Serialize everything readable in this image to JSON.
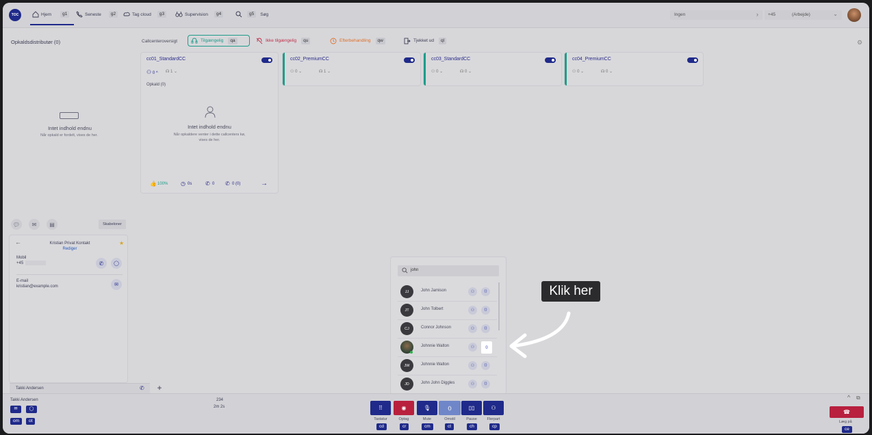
{
  "topbar": {
    "logo": "TOC",
    "nav": [
      {
        "label": "Hjem",
        "key": "g1",
        "icon": "home-icon"
      },
      {
        "label": "Seneste",
        "key": "g2",
        "icon": "phone-icon"
      },
      {
        "label": "Tag cloud",
        "key": "g3",
        "icon": "tag-icon"
      },
      {
        "label": "Supervision",
        "key": "g4",
        "icon": "binoculars-icon"
      },
      {
        "label": "Søg",
        "key": "g5",
        "icon": "search-icon"
      }
    ],
    "status_select": "Ingen",
    "phone_prefix": "+45",
    "phone_label": "(Arbejde)"
  },
  "left_panel": {
    "title": "Opkaldsdistributør (0)",
    "empty_title": "Intet indhold endnu",
    "empty_text": "Når opkald er fordelt, vises de her."
  },
  "callcenter": {
    "label": "Callcenteroversigt",
    "filters": [
      {
        "label": "Tilgængelig",
        "key": "qa"
      },
      {
        "label": "Ikke tilgængelig",
        "key": "qu"
      },
      {
        "label": "Efterbehandling",
        "key": "qw"
      },
      {
        "label": "Tjekket ud",
        "key": "ql"
      }
    ],
    "cards": [
      {
        "name": "cc01_StandardCC",
        "agents": "0",
        "waiting": "1"
      },
      {
        "name": "cc02_PremiumCC",
        "agents": "0",
        "waiting": "1"
      },
      {
        "name": "cc03_StandardCC",
        "agents": "0",
        "waiting": "0"
      },
      {
        "name": "cc04_PremiumCC",
        "agents": "0",
        "waiting": "0"
      }
    ],
    "calls_label": "Opkald (0)",
    "empty_title": "Intet indhold endnu",
    "empty_text": "Når opkaldere venter i dette callcenters kø, vises de her.",
    "stats": {
      "percent": "100%",
      "time": "0s",
      "calls": "0",
      "missed": "0 (0)"
    }
  },
  "contact": {
    "templates_button": "Skabeloner",
    "name": "Kristian Privat Kontakt",
    "edit": "Rediger",
    "mobile_label": "Mobil",
    "mobile_value": "+45",
    "email_label": "E-mail",
    "email_value": "kristian@example.com"
  },
  "search": {
    "query": "john",
    "results": [
      {
        "initials": "JJ",
        "name": "John Jamison"
      },
      {
        "initials": "JT",
        "name": "John Tolbert"
      },
      {
        "initials": "CJ",
        "name": "Connor Johnson"
      },
      {
        "initials": "",
        "name": "Johnnie Walton"
      },
      {
        "initials": "JW",
        "name": "Johnnie Walton"
      },
      {
        "initials": "JD",
        "name": "John John Diggles"
      }
    ]
  },
  "callout": "Klik her",
  "bottom": {
    "tab_name": "Takki Andersen",
    "caller_name": "Takki Andersen",
    "caller_number": "234",
    "duration": "2m 2s",
    "left_keys": [
      "om",
      "ot"
    ],
    "controls": [
      {
        "label": "Tastatur",
        "key": "cd",
        "icon": "keypad-icon"
      },
      {
        "label": "Optag",
        "key": "cr",
        "icon": "record-icon"
      },
      {
        "label": "Mute",
        "key": "cm",
        "icon": "mic-icon"
      },
      {
        "label": "Omstil",
        "key": "ct",
        "icon": "transfer-icon"
      },
      {
        "label": "Pause",
        "key": "ch",
        "icon": "pause-icon"
      },
      {
        "label": "Flerpart",
        "key": "cp",
        "icon": "conference-icon"
      }
    ],
    "hangup_label": "Læg på",
    "hangup_key": "ce"
  },
  "colors": {
    "brand": "#1f2a8a",
    "available": "#1e9c8a",
    "unavailable": "#c0304a",
    "aftercall": "#e0702a",
    "hangup": "#b8203e"
  }
}
